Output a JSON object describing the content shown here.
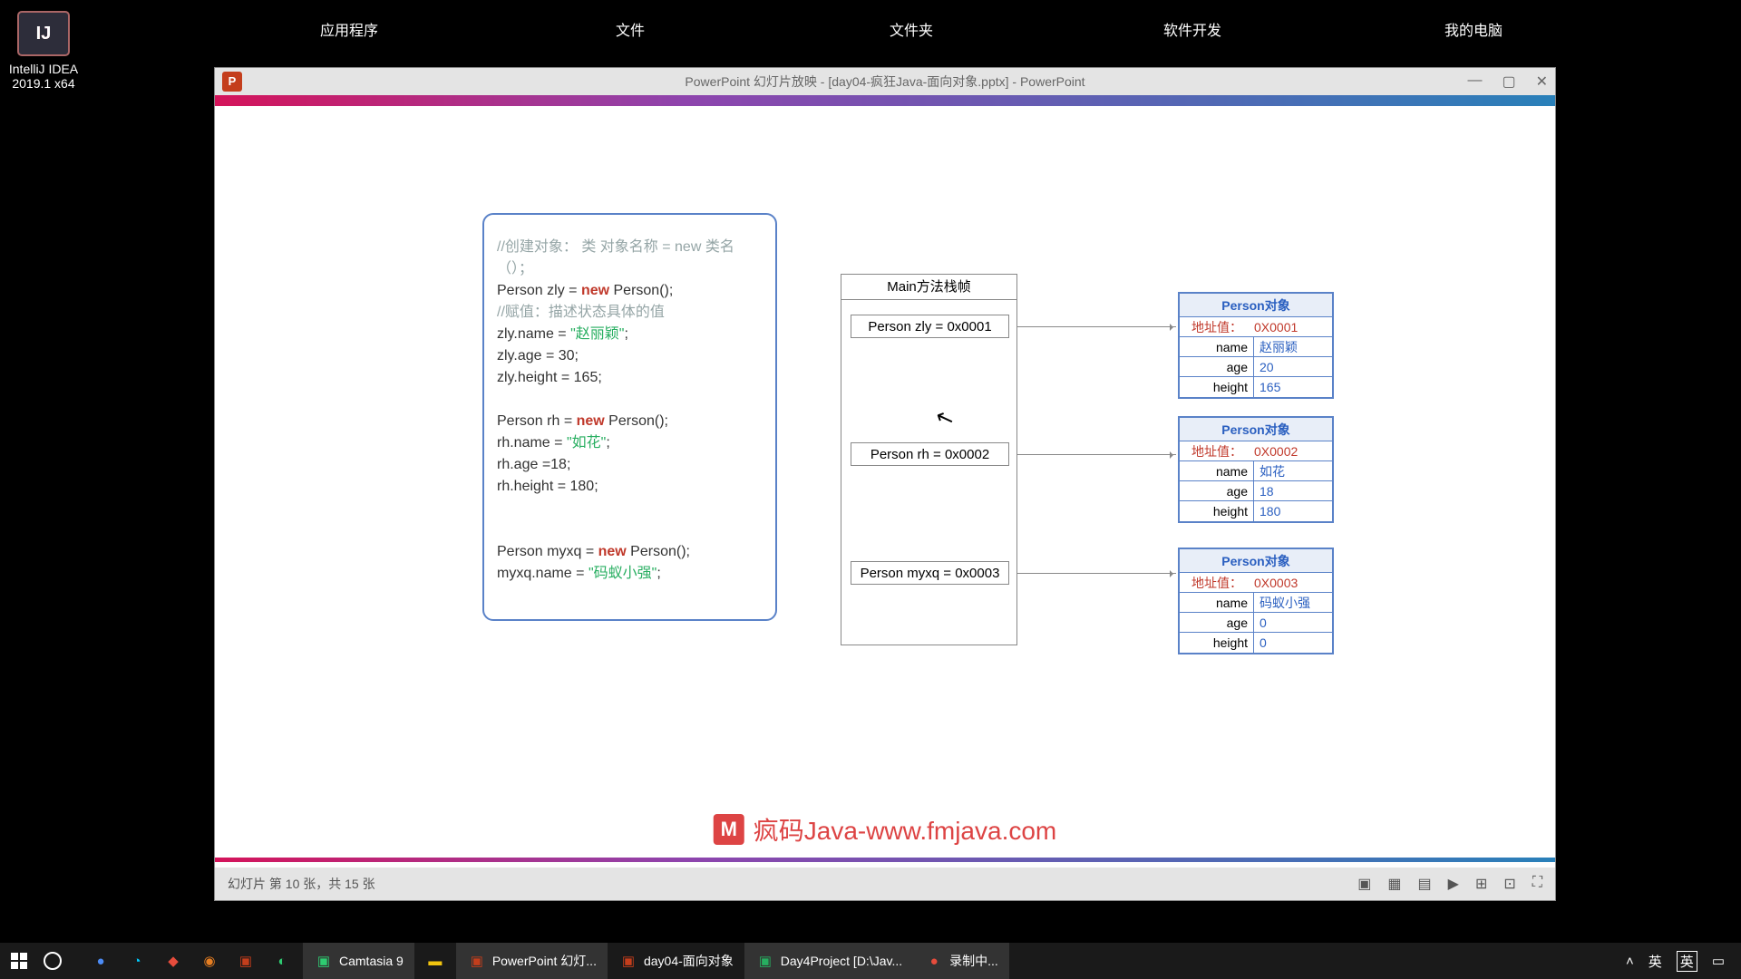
{
  "desktop": {
    "icon_label_1": "IntelliJ IDEA",
    "icon_label_2": "2019.1 x64",
    "icon_glyph": "IJ"
  },
  "topbar": {
    "apps": "应用程序",
    "file": "文件",
    "folder": "文件夹",
    "dev": "软件开发",
    "pc": "我的电脑"
  },
  "ppt": {
    "title": "PowerPoint 幻灯片放映 - [day04-疯狂Java-面向对象.pptx] - PowerPoint",
    "p_glyph": "P",
    "ctrl_min": "—",
    "ctrl_max": "▢",
    "ctrl_close": "✕",
    "status": "幻灯片 第 10 张，共 15 张"
  },
  "code": {
    "c1": "//创建对象：   类 对象名称 = new 类名（）；",
    "l1_a": "Person zly = ",
    "l1_kw": "new",
    "l1_b": " Person();",
    "c2": "//赋值：描述状态具体的值",
    "l3": "zly.name = ",
    "l3_s": "\"赵丽颖\"",
    "l3_e": ";",
    "l4": "zly.age = 30;",
    "l5": "zly.height = 165;",
    "l6_a": "Person rh = ",
    "l6_kw": "new",
    "l6_b": " Person();",
    "l7": "rh.name = ",
    "l7_s": "\"如花\"",
    "l7_e": ";",
    "l8": "rh.age =18;",
    "l9": "rh.height = 180;",
    "l10_a": "Person myxq = ",
    "l10_kw": "new",
    "l10_b": " Person();",
    "l11": "myxq.name = ",
    "l11_s": "\"码蚁小强\"",
    "l11_e": ";"
  },
  "stack": {
    "title": "Main方法栈帧",
    "s1": "Person zly = 0x0001",
    "s2": "Person rh = 0x0002",
    "s3": "Person myxq = 0x0003"
  },
  "objs": [
    {
      "title": "Person对象",
      "addr_l": "地址值：",
      "addr": "0X0001",
      "rows": [
        [
          "name",
          "赵丽颖"
        ],
        [
          "age",
          "20"
        ],
        [
          "height",
          "165"
        ]
      ]
    },
    {
      "title": "Person对象",
      "addr_l": "地址值：",
      "addr": "0X0002",
      "rows": [
        [
          "name",
          "如花"
        ],
        [
          "age",
          "18"
        ],
        [
          "height",
          "180"
        ]
      ]
    },
    {
      "title": "Person对象",
      "addr_l": "地址值：",
      "addr": "0X0003",
      "rows": [
        [
          "name",
          "码蚁小强"
        ],
        [
          "age",
          "0"
        ],
        [
          "height",
          "0"
        ]
      ]
    }
  ],
  "brand": {
    "icon": "M",
    "text": "疯码Java-www.fmjava.com"
  },
  "taskbar": {
    "camtasia": "Camtasia 9",
    "ppshow": "PowerPoint 幻灯...",
    "ppdoc": "day04-面向对象",
    "idea": "Day4Project [D:\\Jav...",
    "rec": "录制中...",
    "ime1": "英",
    "ime2": "英"
  }
}
